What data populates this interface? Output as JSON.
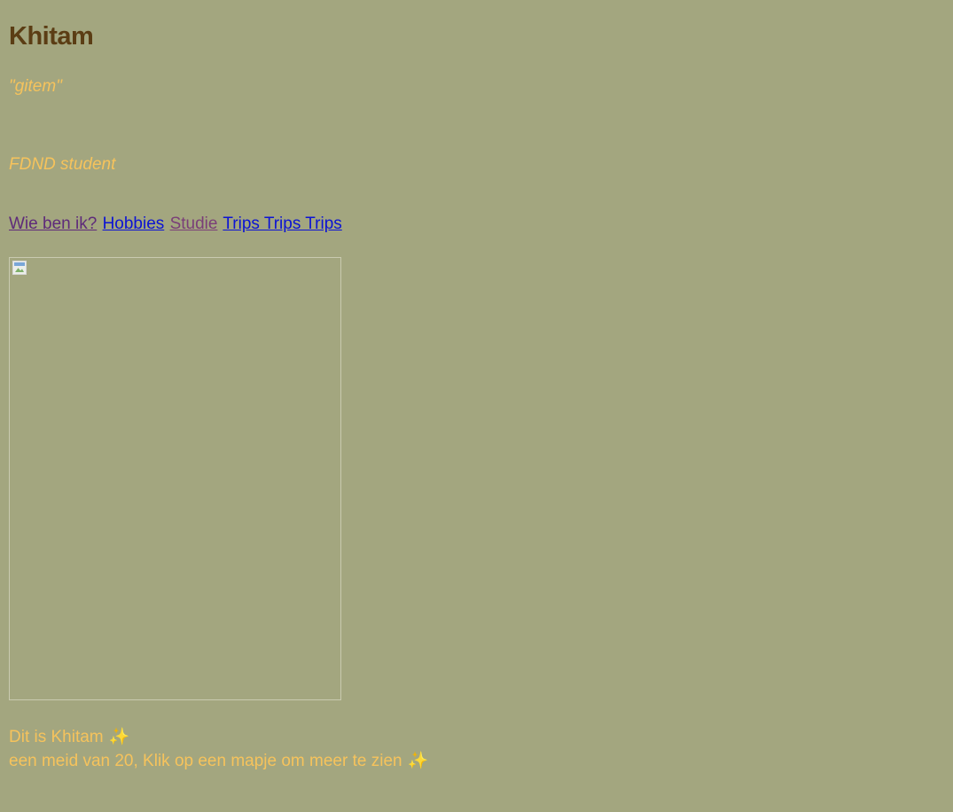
{
  "header": {
    "title": "Khitam",
    "nickname": "\"gitem\"",
    "role": "FDND student"
  },
  "nav": {
    "items": [
      {
        "label": "Wie ben ik?"
      },
      {
        "label": "Hobbies"
      },
      {
        "label": "Studie"
      },
      {
        "label": "Trips Trips Trips"
      }
    ]
  },
  "image": {
    "icon": "broken-image-icon"
  },
  "intro": {
    "line1": "Dit is Khitam",
    "line2": "een meid van 20, Klik op een mapje om meer te zien",
    "emoji": "✨"
  },
  "colors": {
    "background": "#a3a67f",
    "title": "#5b3d14",
    "accent_text": "#f6c35c",
    "link_unvisited": "#0b13d4",
    "link_visited": "#5e2a7a"
  }
}
